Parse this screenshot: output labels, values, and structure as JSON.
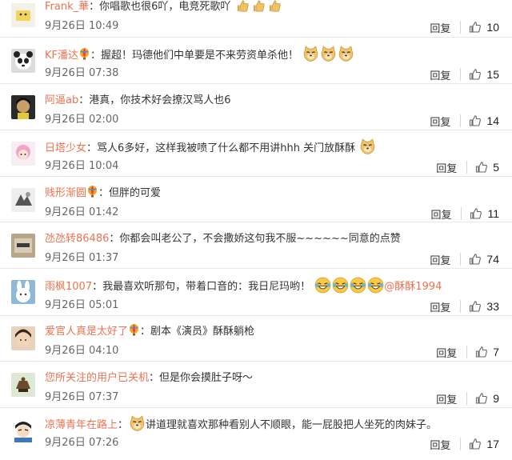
{
  "reply_label": "回复",
  "colors": {
    "username": "#eb7350",
    "username_alt": "#2a7fc9",
    "text": "#333333",
    "meta": "#666666"
  },
  "comments": [
    {
      "user": "Frank_華",
      "colon": "：",
      "text": "你唱歌也很6吖，电竞死歌吖",
      "time": "9月26日 10:49",
      "likes": "10",
      "emoji": [
        "thumbs-up-emoji",
        "thumbs-up-emoji",
        "thumbs-up-emoji"
      ]
    },
    {
      "user": "KF潘达",
      "colon": "：",
      "text": "握超！玛德他们中单要是不来劳资单杀他！",
      "time": "9月26日 07:38",
      "likes": "15",
      "badge": "balloon-badge",
      "emoji": [
        "doge-emoji",
        "doge-emoji",
        "doge-emoji"
      ]
    },
    {
      "user": "阿逼ab",
      "colon": "：",
      "text": "港真，你技术好会撩汉骂人也6",
      "time": "9月26日 02:00",
      "likes": "14"
    },
    {
      "user": "日塔少女",
      "colon": "：",
      "text": "骂人6多好，这样我被喷了什么都不用讲hhh 关门放酥酥",
      "time": "9月26日 10:04",
      "likes": "5",
      "emoji": [
        "doge-emoji"
      ]
    },
    {
      "user": "贱形渐圆",
      "colon": "：",
      "text": "但胖的可爱",
      "time": "9月26日 01:42",
      "likes": "11",
      "badge": "balloon-badge"
    },
    {
      "user": "氹氹转86486",
      "colon": "：",
      "text": "你都会叫老公了，不会撒娇这句我不服~~~~~~同意的点赞",
      "time": "9月26日 01:37",
      "likes": "74"
    },
    {
      "user": "雨枫1007",
      "colon": "：",
      "text": "我最喜欢听那句，带着口音的：我日尼玛哟！",
      "mention": "@酥酥1994",
      "time": "9月26日 05:01",
      "likes": "33",
      "emoji": [
        "laugh-cry-emoji",
        "laugh-cry-emoji",
        "laugh-cry-emoji",
        "laugh-cry-emoji"
      ]
    },
    {
      "user": "爱官人真是太好了",
      "colon": "：",
      "text": "剧本《演员》酥酥躺枪",
      "time": "9月26日 04:10",
      "likes": "7",
      "badge": "balloon-badge"
    },
    {
      "user": "您所关注的用户已关机",
      "colon": "：",
      "text": "但是你会摸肚子呀～",
      "time": "9月26日 07:37",
      "likes": "9"
    },
    {
      "user": "凉薄青年在路上",
      "colon": "：",
      "text": "讲道理就喜欢那种看别人不顺眼，能一屁股把人坐死的肉妹子。",
      "time": "9月26日 07:26",
      "likes": "17",
      "emoji_before_text": "doge-emoji"
    }
  ]
}
